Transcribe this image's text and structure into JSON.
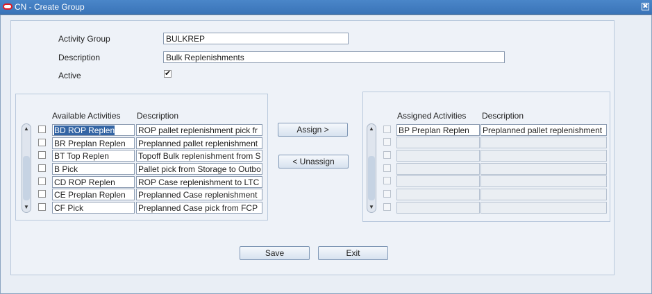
{
  "window": {
    "title": "CN - Create Group",
    "close_symbol": "✖"
  },
  "form": {
    "activity_group_label": "Activity Group",
    "activity_group_value": "BULKREP",
    "description_label": "Description",
    "description_value": "Bulk Replenishments",
    "active_label": "Active",
    "active_checked": true
  },
  "available": {
    "header_activity": "Available Activities",
    "header_description": "Description",
    "rows": [
      {
        "activity": "BD ROP Replen",
        "description": "ROP pallet replenishment pick fr"
      },
      {
        "activity": "BR Preplan Replen",
        "description": "Preplanned pallet replenishment"
      },
      {
        "activity": "BT Top Replen",
        "description": "Topoff Bulk replenishment from S"
      },
      {
        "activity": "B Pick",
        "description": "Pallet pick from Storage to Outbo"
      },
      {
        "activity": "CD ROP Replen",
        "description": "ROP Case replenishment to LTC"
      },
      {
        "activity": "CE Preplan Replen",
        "description": "Preplanned Case replenishment"
      },
      {
        "activity": "CF Pick",
        "description": "Preplanned Case pick from FCP"
      }
    ]
  },
  "assigned": {
    "header_activity": "Assigned Activities",
    "header_description": "Description",
    "rows": [
      {
        "activity": "BP Preplan Replen",
        "description": "Preplanned pallet replenishment"
      },
      {
        "activity": "",
        "description": ""
      },
      {
        "activity": "",
        "description": ""
      },
      {
        "activity": "",
        "description": ""
      },
      {
        "activity": "",
        "description": ""
      },
      {
        "activity": "",
        "description": ""
      },
      {
        "activity": "",
        "description": ""
      }
    ]
  },
  "buttons": {
    "assign": "Assign >",
    "unassign": "< Unassign",
    "save": "Save",
    "exit": "Exit"
  },
  "scroll": {
    "up": "▲",
    "down": "▼"
  },
  "colors": {
    "titlebar": "#3a74b8",
    "selection": "#3465a4",
    "panel": "#eef2f8"
  }
}
